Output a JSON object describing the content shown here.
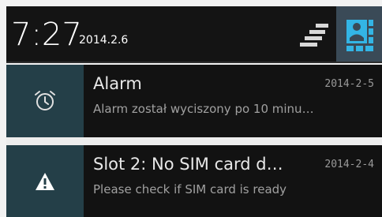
{
  "status_header": {
    "time": "7:27",
    "date": "2014.2.6",
    "clear_icon": "clear-all-icon",
    "settings_icon": "quick-settings-icon"
  },
  "notifications": [
    {
      "icon": "alarm-clock-icon",
      "title": "Alarm",
      "when": "2014-2-5",
      "text": "Alarm został wyciszony po 10 minu…"
    },
    {
      "icon": "warning-icon",
      "title": "Slot 2: No SIM card d…",
      "when": "2014-2-4",
      "text": "Please check if SIM card is ready"
    }
  ],
  "colors": {
    "header_bg": "#141414",
    "settings_bg": "#3a4a57",
    "icon_box_bg": "#243f48",
    "accent_blue": "#33b5e5"
  }
}
